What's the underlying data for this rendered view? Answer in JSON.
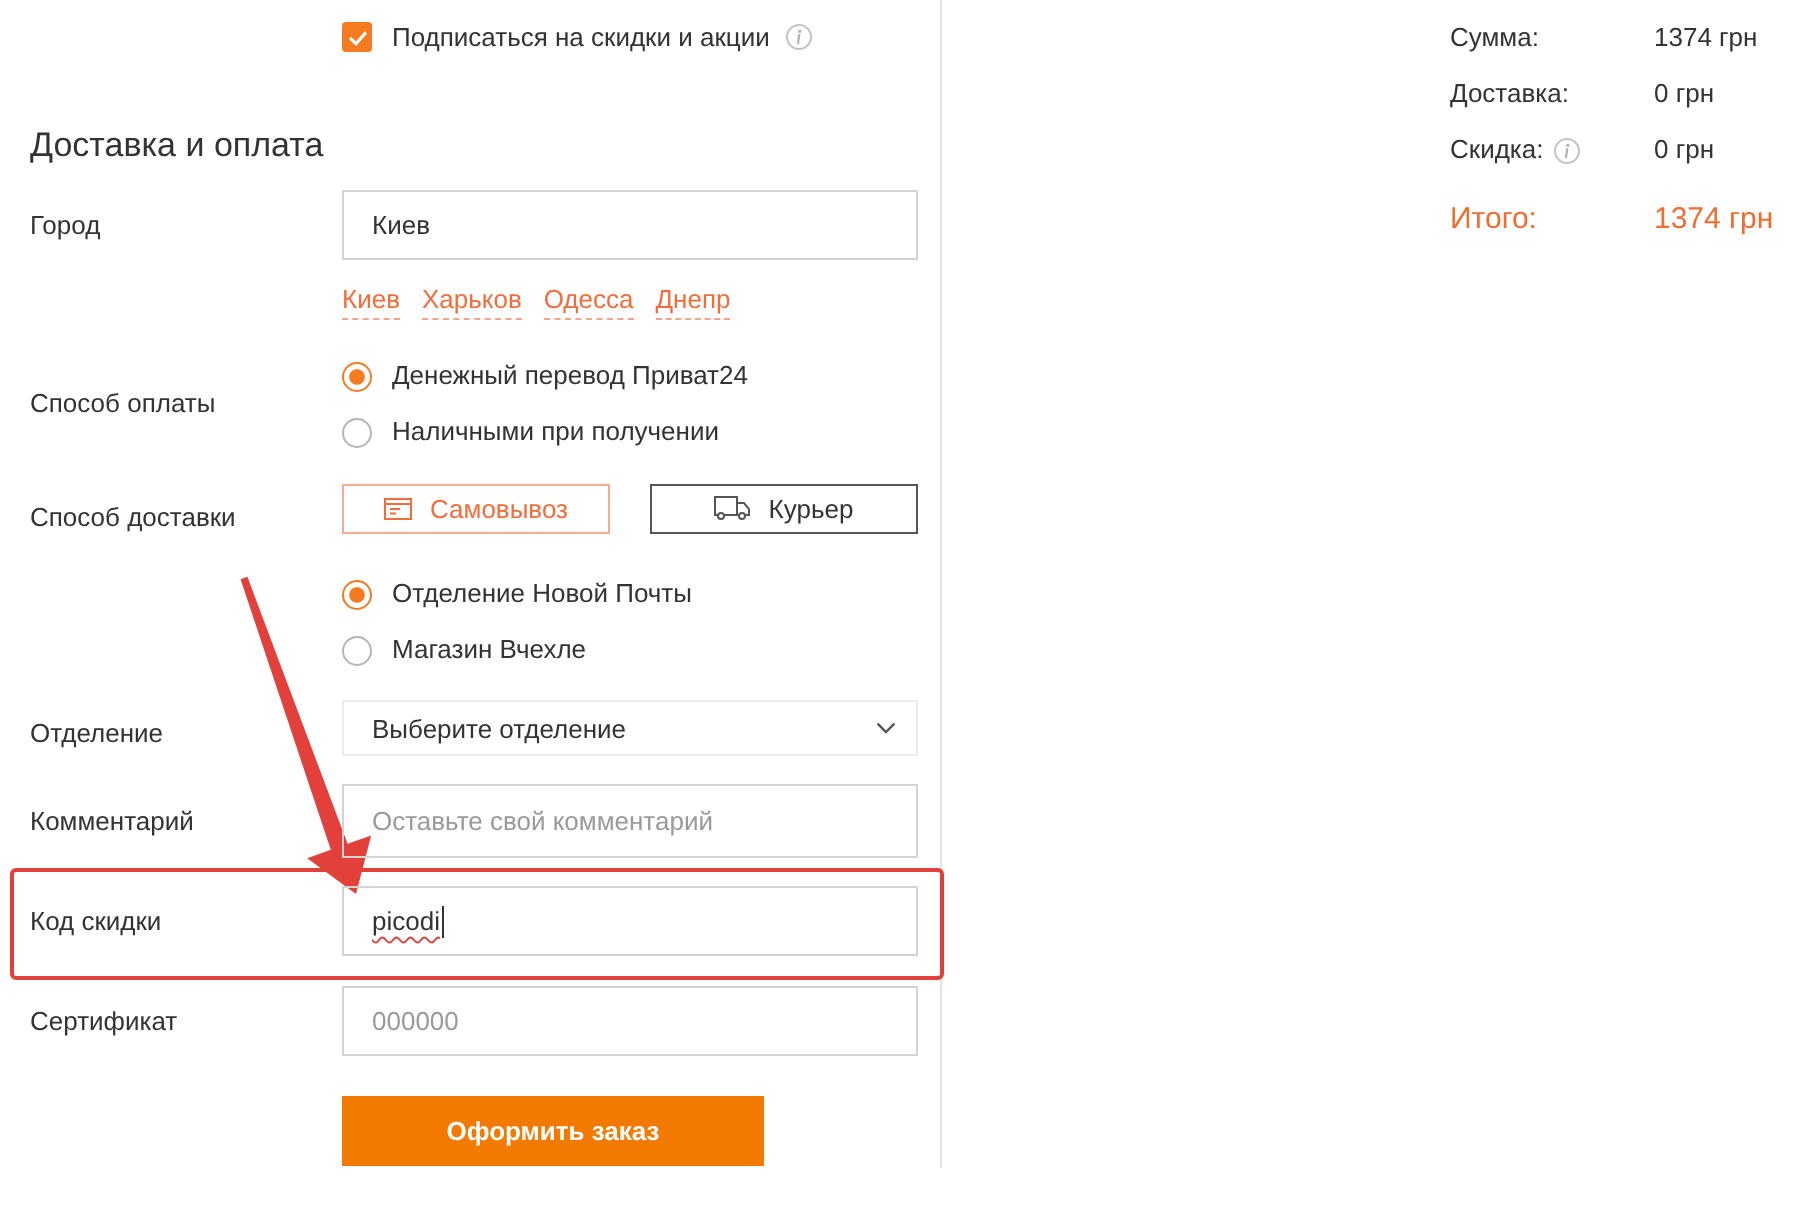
{
  "subscribe": {
    "label": "Подписаться на скидки и акции",
    "checked": true,
    "info": true
  },
  "section_title": "Доставка и оплата",
  "city": {
    "label": "Город",
    "value": "Киев",
    "suggestions": [
      "Киев",
      "Харьков",
      "Одесса",
      "Днепр"
    ]
  },
  "payment": {
    "label": "Способ оплаты",
    "options": [
      {
        "label": "Денежный перевод Приват24",
        "selected": true
      },
      {
        "label": "Наличными при получении",
        "selected": false
      }
    ]
  },
  "delivery": {
    "label": "Способ доставки",
    "methods": [
      {
        "kind": "pickup",
        "label": "Самовывоз",
        "selected": true
      },
      {
        "kind": "courier",
        "label": "Курьер",
        "selected": false
      }
    ],
    "options": [
      {
        "label": "Отделение Новой Почты",
        "selected": true
      },
      {
        "label": "Магазин Вчехле",
        "selected": false
      }
    ]
  },
  "branch": {
    "label": "Отделение",
    "value": "Выберите отделение"
  },
  "comment": {
    "label": "Комментарий",
    "placeholder": "Оставьте свой комментарий"
  },
  "discount_code": {
    "label": "Код скидки",
    "value": "picodi",
    "focused": true,
    "misspelled": true,
    "highlighted": true
  },
  "certificate": {
    "label": "Сертификат",
    "placeholder": "000000"
  },
  "submit_button": "Оформить заказ",
  "summary": {
    "rows": [
      {
        "label": "Сумма:",
        "value": "1374 грн",
        "info": false
      },
      {
        "label": "Доставка:",
        "value": "0 грн",
        "info": false
      },
      {
        "label": "Скидка:",
        "value": "0 грн",
        "info": true
      }
    ],
    "total": {
      "label": "Итого:",
      "value": "1374 грн"
    }
  }
}
